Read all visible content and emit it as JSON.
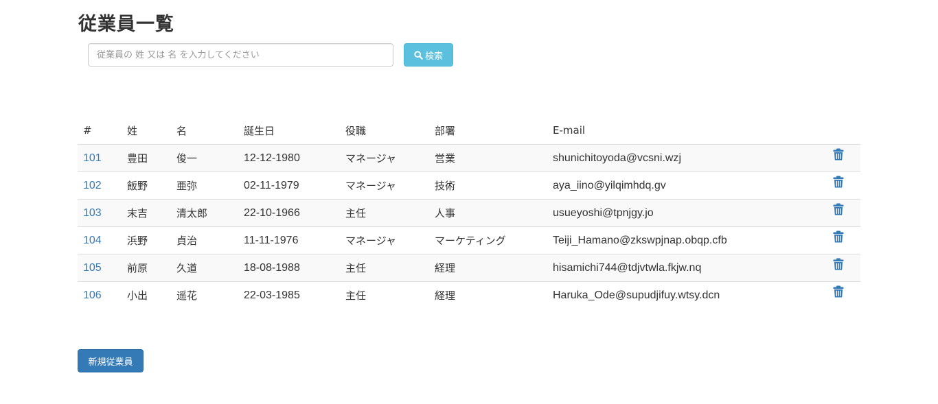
{
  "page": {
    "title": "従業員一覧"
  },
  "search": {
    "placeholder": "従業員の 姓 又は 名 を入力してください",
    "value": "",
    "button_label": "検索",
    "button_icon": "search-icon"
  },
  "table": {
    "columns": [
      "#",
      "姓",
      "名",
      "誕生日",
      "役職",
      "部署",
      "E-mail"
    ],
    "rows": [
      {
        "id": "101",
        "last_name": "豊田",
        "first_name": "俊一",
        "birthday": "12-12-1980",
        "position": "マネージャ",
        "department": "営業",
        "email": "shunichitoyoda@vcsni.wzj"
      },
      {
        "id": "102",
        "last_name": "飯野",
        "first_name": "亜弥",
        "birthday": "02-11-1979",
        "position": "マネージャ",
        "department": "技術",
        "email": "aya_iino@yilqimhdq.gv"
      },
      {
        "id": "103",
        "last_name": "末吉",
        "first_name": "清太郎",
        "birthday": "22-10-1966",
        "position": "主任",
        "department": "人事",
        "email": "usueyoshi@tpnjgy.jo"
      },
      {
        "id": "104",
        "last_name": "浜野",
        "first_name": "貞治",
        "birthday": "11-11-1976",
        "position": "マネージャ",
        "department": "マーケティング",
        "email": "Teiji_Hamano@zkswpjnap.obqp.cfb"
      },
      {
        "id": "105",
        "last_name": "前原",
        "first_name": "久道",
        "birthday": "18-08-1988",
        "position": "主任",
        "department": "経理",
        "email": "hisamichi744@tdjvtwla.fkjw.nq"
      },
      {
        "id": "106",
        "last_name": "小出",
        "first_name": "遥花",
        "birthday": "22-03-1985",
        "position": "主任",
        "department": "経理",
        "email": "Haruka_Ode@supudjifuy.wtsy.dcn"
      }
    ],
    "row_action_icon": "trash-icon"
  },
  "actions": {
    "new_employee_label": "新規従業員"
  },
  "colors": {
    "link": "#337ab7",
    "info_button": "#5bc0de",
    "primary_button": "#337ab7",
    "stripe": "#f9f9f9",
    "border": "#dddddd"
  }
}
